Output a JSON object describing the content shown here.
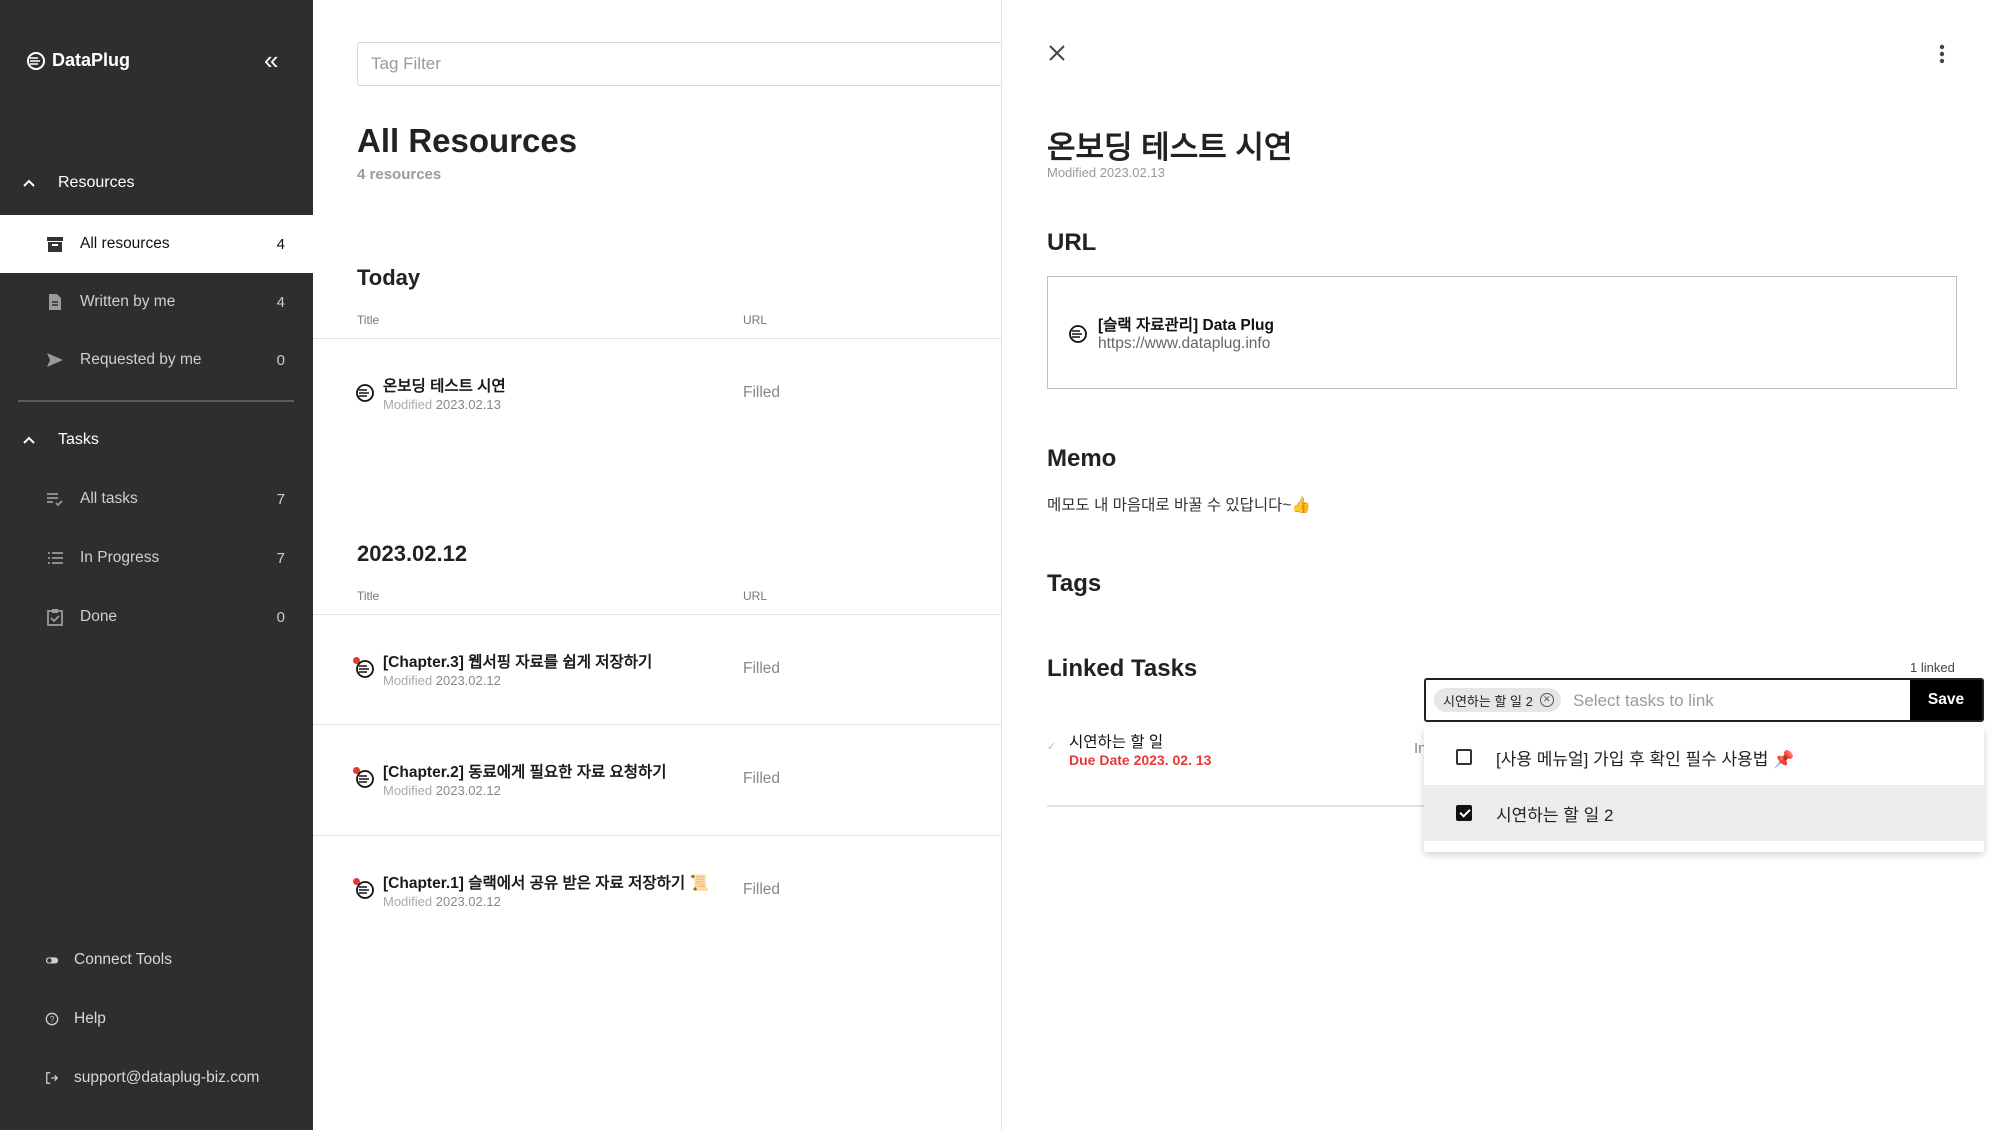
{
  "sidebar": {
    "brand": "DataPlug",
    "sections": [
      {
        "label": "Resources"
      },
      {
        "label": "Tasks"
      }
    ],
    "resources": [
      {
        "label": "All resources",
        "count": "4"
      },
      {
        "label": "Written by me",
        "count": "4"
      },
      {
        "label": "Requested by me",
        "count": "0"
      }
    ],
    "tasks": [
      {
        "label": "All tasks",
        "count": "7"
      },
      {
        "label": "In Progress",
        "count": "7"
      },
      {
        "label": "Done",
        "count": "0"
      }
    ],
    "footer": [
      {
        "label": "Connect Tools"
      },
      {
        "label": "Help"
      },
      {
        "label": "support@dataplug-biz.com"
      }
    ]
  },
  "main": {
    "tag_filter_placeholder": "Tag Filter",
    "title": "All Resources",
    "subtitle": "4 resources",
    "columns": {
      "title": "Title",
      "url": "URL"
    },
    "groups": [
      {
        "label": "Today",
        "rows": [
          {
            "title": "온보딩 테스트 시연",
            "modified_label": "Modified",
            "modified": "2023.02.13",
            "url": "Filled"
          }
        ]
      },
      {
        "label": "2023.02.12",
        "rows": [
          {
            "title": "[Chapter.3] 웹서핑 자료를 쉽게 저장하기",
            "modified_label": "Modified",
            "modified": "2023.02.12",
            "url": "Filled"
          },
          {
            "title": "[Chapter.2] 동료에게 필요한 자료 요청하기",
            "modified_label": "Modified",
            "modified": "2023.02.12",
            "url": "Filled"
          },
          {
            "title": "[Chapter.1] 슬랙에서 공유 받은 자료 저장하기 📜",
            "modified_label": "Modified",
            "modified": "2023.02.12",
            "url": "Filled"
          }
        ]
      }
    ]
  },
  "detail": {
    "title": "온보딩 테스트 시연",
    "modified": "Modified 2023.02.13",
    "url_heading": "URL",
    "url_card": {
      "title": "[슬랙 자료관리] Data Plug",
      "link": "https://www.dataplug.info"
    },
    "memo_heading": "Memo",
    "memo": "메모도 내 마음대로 바꿀 수 있답니다~👍",
    "tags_heading": "Tags",
    "linked_heading": "Linked Tasks",
    "linked_count": "1 linked",
    "task": {
      "name": "시연하는 할 일",
      "due": "Due Date 2023. 02. 13",
      "status_partial": "In"
    },
    "selector": {
      "chip": "시연하는 할 일 2",
      "placeholder": "Select tasks to link",
      "save": "Save",
      "options": [
        {
          "label": "[사용 메뉴얼] 가입 후 확인 필수 사용법 📌",
          "checked": false
        },
        {
          "label": "시연하는 할 일 2",
          "checked": true
        }
      ]
    }
  },
  "colors": {
    "sidebar_bg": "#2e2e2e",
    "due_red": "#e53935",
    "accent": "#000000"
  }
}
